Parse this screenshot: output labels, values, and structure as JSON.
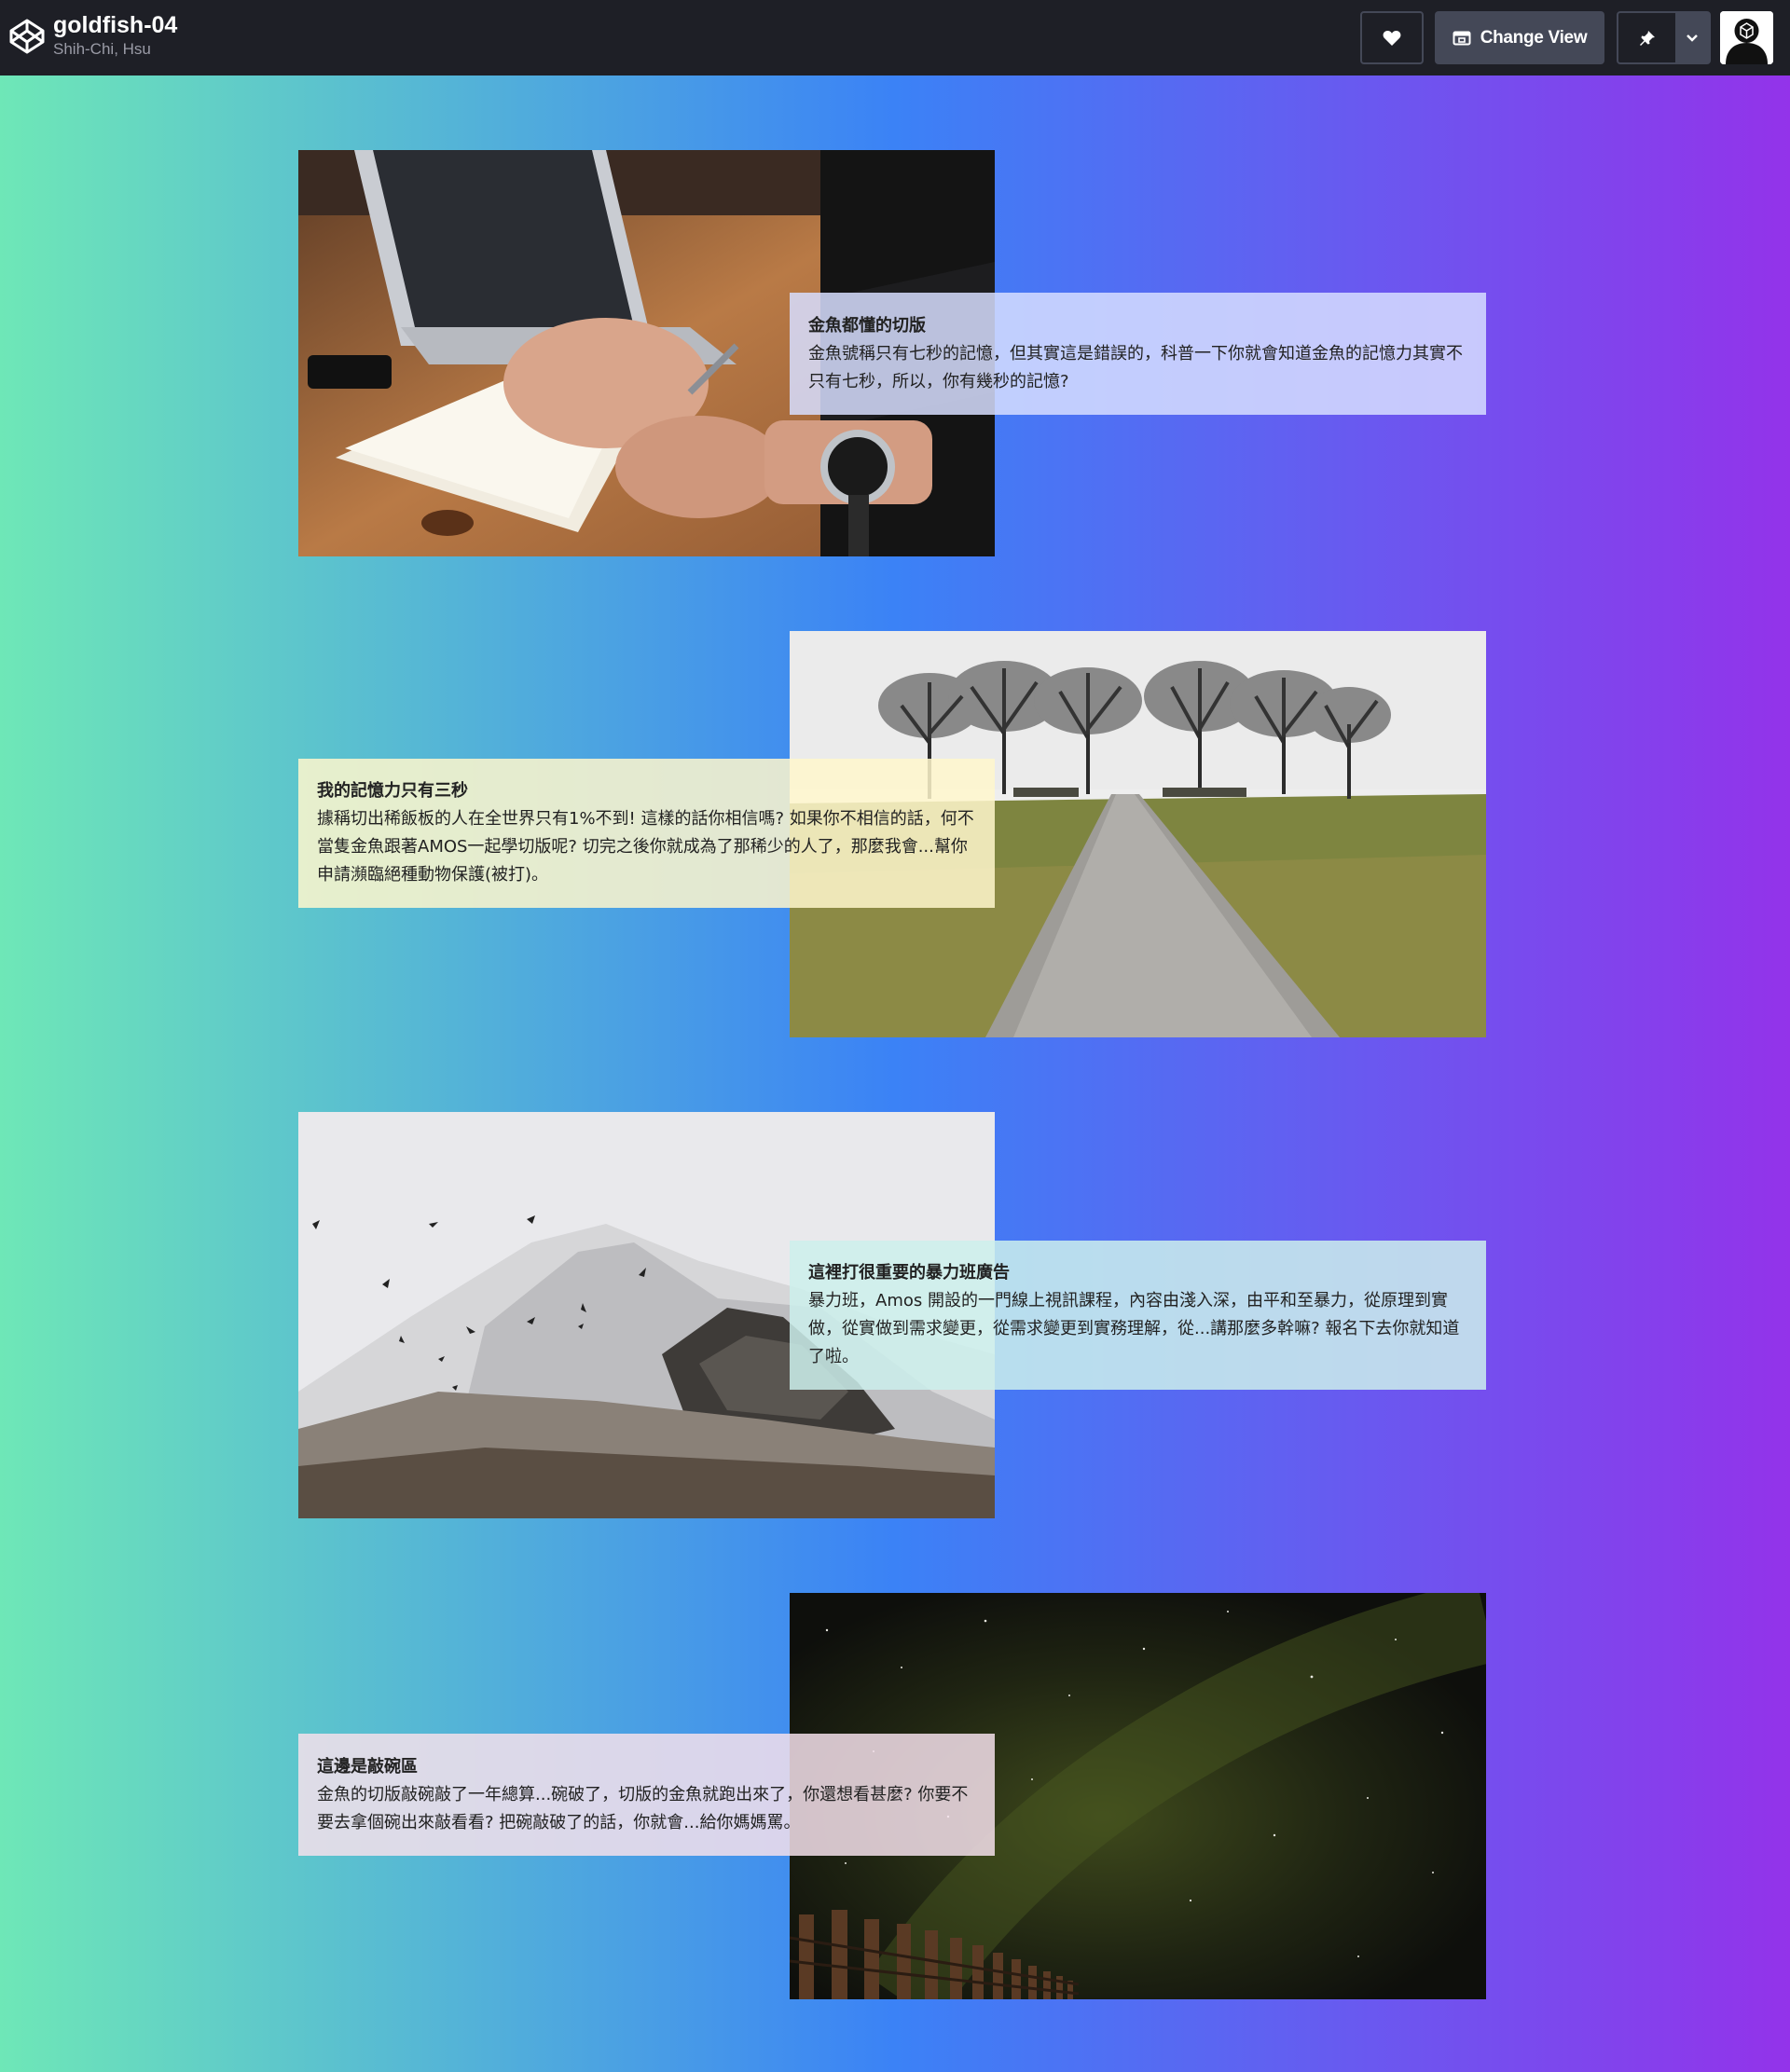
{
  "header": {
    "pen_title": "goldfish-04",
    "author": "Shih-Chi, Hsu",
    "change_view_label": "Change View"
  },
  "icons": {
    "logo": "codepen-logo-icon",
    "like": "heart-icon",
    "view": "layout-icon",
    "pin": "pin-icon",
    "more": "chevron-down-icon"
  },
  "colors": {
    "header_bg": "#1e1f26",
    "button_bg": "#444857",
    "gradient_start": "#6ee7b7",
    "gradient_mid": "#3b82f6",
    "gradient_end": "#9333ea",
    "card1_bg": "rgba(215,222,255,0.85)",
    "card2_bg": "rgba(255,247,204,0.85)",
    "card3_bg": "rgba(204,240,236,0.85)",
    "card4_bg": "rgba(245,225,235,0.85)"
  },
  "sections": [
    {
      "photo": "hand-writing-notebook-laptop-photo",
      "title": "金魚都懂的切版",
      "text": "金魚號稱只有七秒的記憶，但其實這是錯誤的，科普一下你就會知道金魚的記憶力其實不只有七秒，所以，你有幾秒的記憶?"
    },
    {
      "photo": "path-trees-field-photo",
      "title": "我的記憶力只有三秒",
      "text": "據稱切出稀飯板的人在全世界只有1%不到! 這樣的話你相信嗎? 如果你不相信的話，何不當隻金魚跟著AMOS一起學切版呢? 切完之後你就成為了那稀少的人了，那麼我會...幫你申請瀕臨絕種動物保護(被打)。"
    },
    {
      "photo": "snowy-mountain-birds-photo",
      "title": "這裡打很重要的暴力班廣告",
      "text": "暴力班，Amos 開設的一門線上視訊課程，內容由淺入深，由平和至暴力，從原理到實做，從實做到需求變更，從需求變更到實務理解，從...講那麼多幹嘛? 報名下去你就知道了啦。"
    },
    {
      "photo": "night-sky-fence-photo",
      "title": "這邊是敲碗區",
      "text": "金魚的切版敲碗敲了一年總算...碗破了，切版的金魚就跑出來了，你還想看甚麼? 你要不要去拿個碗出來敲看看? 把碗敲破了的話，你就會...給你媽媽罵。"
    }
  ]
}
